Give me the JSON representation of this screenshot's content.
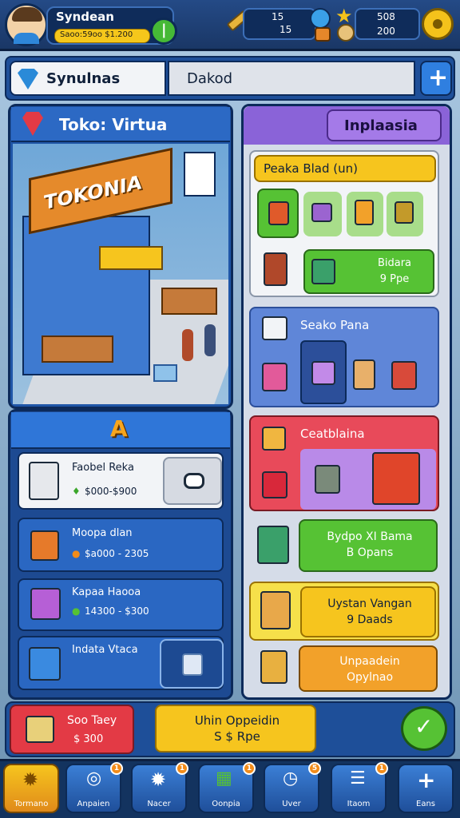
{
  "header": {
    "player_name": "Syndean",
    "currency_text": "Saoo:59oo $1.200",
    "stat1_top": "15",
    "stat1_bottom": "15",
    "stat2_top": "508",
    "stat2_bottom": "200"
  },
  "tabs": {
    "tab1": "Synulnas",
    "tab2": "Dakod",
    "add_label": "+"
  },
  "store": {
    "title": "Toko: Virtua",
    "sign_text": "TOKONIA",
    "banner_text": "A"
  },
  "inventory_list": [
    {
      "name": "Faobel Reka",
      "price": "$000-$900"
    },
    {
      "name": "Moopa dlan",
      "price": "$a000 - 2305"
    },
    {
      "name": "Kapaa Haooa",
      "price": "14300 - $300"
    },
    {
      "name": "Indata Vtaca",
      "price": ""
    }
  ],
  "right_panel": {
    "header": "Inplaasia",
    "section1_title": "Peaka Blad (un)",
    "section1_button": "Bidara\n9 Ppe",
    "section2_title": "Seako Pana",
    "section3_title": "Ceatblaina",
    "section3_button": "Bydpo XI Bama\nB Opans",
    "section4_button": "Uystan Vangan\n9 Daads",
    "section5_button": "Unpaadein\nOpylnao"
  },
  "bottom_actions": {
    "left_label": "Soo Taey",
    "left_price": "$ 300",
    "center_button": "Uhin Oppeidin\nS $ Rpe"
  },
  "nav": [
    {
      "label": "Tormano",
      "icon": "gear-icon",
      "badge": ""
    },
    {
      "label": "Anpaien",
      "icon": "search-icon",
      "badge": "1"
    },
    {
      "label": "Nacer",
      "icon": "gear-icon",
      "badge": "1"
    },
    {
      "label": "Oonpia",
      "icon": "money-icon",
      "badge": "1"
    },
    {
      "label": "Uver",
      "icon": "clock-icon",
      "badge": "5"
    },
    {
      "label": "Itaom",
      "icon": "list-icon",
      "badge": "1"
    },
    {
      "label": "Eans",
      "icon": "plus-icon",
      "badge": ""
    }
  ],
  "colors": {
    "frame_blue": "#1e4f99",
    "panel_purple": "#8a63d8",
    "accent_green": "#56c234",
    "accent_yellow": "#f6c51e",
    "accent_red": "#e33a45"
  }
}
